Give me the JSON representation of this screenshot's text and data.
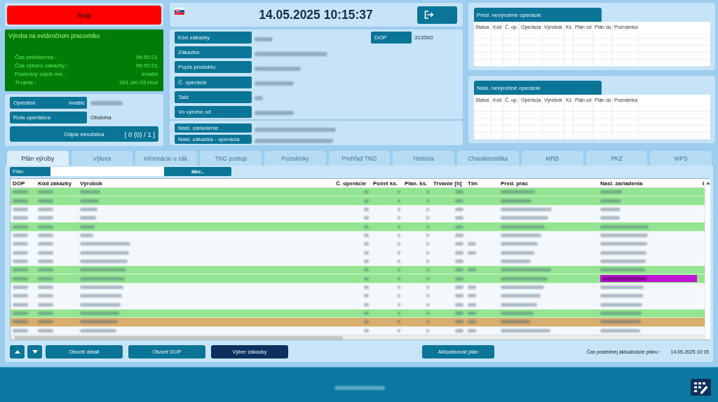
{
  "left": {
    "stop_button": "Stop",
    "production": {
      "title": "Výroba na evidenčnom pracovisku",
      "rows": [
        {
          "label": "Čas prihlásenia :",
          "value": "06:50:21"
        },
        {
          "label": "Čas výberu zákazky :",
          "value": "06:50:21"
        },
        {
          "label": "Posledný odpis mn. :",
          "value": "invalid"
        },
        {
          "label": "Trvanie :",
          "value": "001 dní 03 Hod"
        }
      ]
    },
    "operator": [
      {
        "label": "Operátor",
        "name": "nvašic",
        "blurred": true
      },
      {
        "label": "Rola operátora",
        "value": "Obsluha",
        "blurred": false
      }
    ],
    "writeoff_button": {
      "label": "Odpis množstva",
      "count": "[ 0 (0) / 1 ]"
    }
  },
  "header": {
    "datetime": "14.05.2025 10:15:37"
  },
  "order": {
    "fields": [
      {
        "label": "Kód zákazky",
        "blurred": true
      },
      {
        "label": "Zákazka",
        "blurred": true
      },
      {
        "label": "Popis produktu",
        "blurred": true
      },
      {
        "label": "Č. operácie",
        "blurred": true
      },
      {
        "label": "Takt",
        "blurred": true
      },
      {
        "label": "Vo výrobe od",
        "blurred": true
      }
    ],
    "dop": {
      "label": "DOP",
      "value": "315560"
    }
  },
  "next": {
    "fields": [
      {
        "label": "Nasl. zariadenie",
        "blurred": true
      },
      {
        "label": "Nasl. zákazka - operácia",
        "blurred": true
      }
    ]
  },
  "side_tables": [
    {
      "title": "Pred. nevýrobné operácie",
      "columns": [
        "Status",
        "Kód",
        "Č. op.",
        "Operácia",
        "Výrobok",
        "Ks",
        "Plán od",
        "Plán do",
        "Poznámka"
      ]
    },
    {
      "title": "Nasl. nevýrobné operácie",
      "columns": [
        "Status",
        "Kód",
        "Č. op.",
        "Operácia",
        "Výrobok",
        "Ks",
        "Plán od",
        "Plán do",
        "Poznámka"
      ]
    }
  ],
  "tabs": [
    {
      "label": "Plán výroby",
      "selected": true,
      "disabled": false
    },
    {
      "label": "Výkres",
      "selected": false,
      "disabled": true
    },
    {
      "label": "Informácie o zák.",
      "selected": false,
      "disabled": true
    },
    {
      "label": "TNG postup",
      "selected": false,
      "disabled": true
    },
    {
      "label": "Poznámky",
      "selected": false,
      "disabled": true
    },
    {
      "label": "Prehľad TNG",
      "selected": false,
      "disabled": true
    },
    {
      "label": "História",
      "selected": false,
      "disabled": true
    },
    {
      "label": "Charakteristika",
      "selected": false,
      "disabled": true
    },
    {
      "label": "MRB",
      "selected": false,
      "disabled": true
    },
    {
      "label": "PKZ",
      "selected": false,
      "disabled": true
    },
    {
      "label": "WPS",
      "selected": false,
      "disabled": true
    }
  ],
  "filter": {
    "label": "Filter",
    "button": "abc.."
  },
  "table": {
    "columns": [
      "DOP",
      "Kód zákazky",
      "Výrobok",
      "Č. operácie",
      "Počet ks.",
      "Plán. ks.",
      "Trvanie [h]",
      "Tím",
      "Pred. prac",
      "Nasl. zariadenia",
      "I"
    ],
    "rows": [
      {
        "color": "#94e592",
        "alert": false,
        "tim_blurred": false
      },
      {
        "color": "#94e592",
        "alert": false,
        "tim_blurred": false
      },
      {
        "color": "#f4f8fb",
        "alert": false,
        "tim_blurred": false
      },
      {
        "color": "#f4f8fb",
        "alert": false,
        "tim_blurred": false
      },
      {
        "color": "#94e592",
        "alert": false,
        "tim_blurred": false
      },
      {
        "color": "#f4f8fb",
        "alert": false,
        "tim_blurred": false
      },
      {
        "color": "#f4f8fb",
        "alert": false,
        "tim_blurred": true
      },
      {
        "color": "#f4f8fb",
        "alert": false,
        "tim_blurred": true
      },
      {
        "color": "#f4f8fb",
        "alert": false,
        "tim_blurred": false
      },
      {
        "color": "#94e592",
        "alert": false,
        "tim_blurred": true
      },
      {
        "color": "#94e592",
        "alert": true,
        "tim_blurred": false
      },
      {
        "color": "#f4f8fb",
        "alert": false,
        "tim_blurred": true
      },
      {
        "color": "#f4f8fb",
        "alert": false,
        "tim_blurred": true
      },
      {
        "color": "#f4f8fb",
        "alert": false,
        "tim_blurred": true
      },
      {
        "color": "#94e592",
        "alert": false,
        "tim_blurred": true
      },
      {
        "color": "#d8ae6c",
        "alert": false,
        "tim_blurred": true
      },
      {
        "color": "#f4f8fb",
        "alert": false,
        "tim_blurred": true
      }
    ]
  },
  "bottom": {
    "nav_buttons": [
      {
        "kind": "up"
      },
      {
        "kind": "down"
      }
    ],
    "buttons": [
      {
        "label": "Otvoriť detail",
        "selected": false
      },
      {
        "label": "Otvoriť DOP",
        "selected": false
      },
      {
        "label": "Výber zákazky",
        "selected": true
      }
    ],
    "refresh_button": "Aktualizovať plán",
    "last_update": {
      "label": "Čas poslednej aktualizácie plánu :",
      "value": "14.05.2025 10:15"
    }
  },
  "footer": {
    "title_blurred": true
  }
}
